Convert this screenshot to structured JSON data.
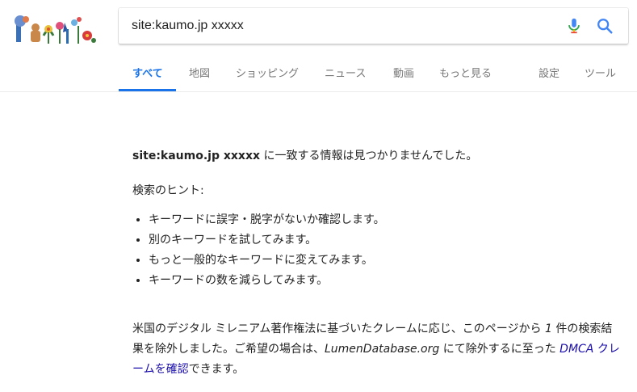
{
  "search": {
    "query": "site:kaumo.jp xxxxx"
  },
  "tabs": [
    {
      "label": "すべて",
      "active": true
    },
    {
      "label": "地図",
      "active": false
    },
    {
      "label": "ショッピング",
      "active": false
    },
    {
      "label": "ニュース",
      "active": false
    },
    {
      "label": "動画",
      "active": false
    },
    {
      "label": "もっと見る",
      "active": false
    },
    {
      "label": "設定",
      "active": false
    },
    {
      "label": "ツール",
      "active": false
    }
  ],
  "results": {
    "query_bold": "site:kaumo.jp xxxxx",
    "not_found_suffix": " に一致する情報は見つかりませんでした。",
    "hints_title": "検索のヒント:",
    "hints": [
      "キーワードに誤字・脱字がないか確認します。",
      "別のキーワードを試してみます。",
      "もっと一般的なキーワードに変えてみます。",
      "キーワードの数を減らしてみます。"
    ],
    "dmca": {
      "part1": "米国のデジタル ミレニアム著作権法に基づいたクレームに応じ、このページから ",
      "count": "1",
      "part2": " 件の検索結果を除外しました。ご希望の場合は、",
      "lumen": "LumenDatabase.org",
      "part3": " にて除外するに至った ",
      "link_dmca": "DMCA",
      "link_claim": " クレームを確認",
      "part4": "できます。"
    }
  },
  "colors": {
    "accent": "#1a73e8",
    "link": "#1a0dab",
    "tab_text": "#777777",
    "text": "#222222"
  },
  "icons": {
    "logo": "google-doodle-logo",
    "mic": "mic-icon",
    "search": "search-icon"
  }
}
